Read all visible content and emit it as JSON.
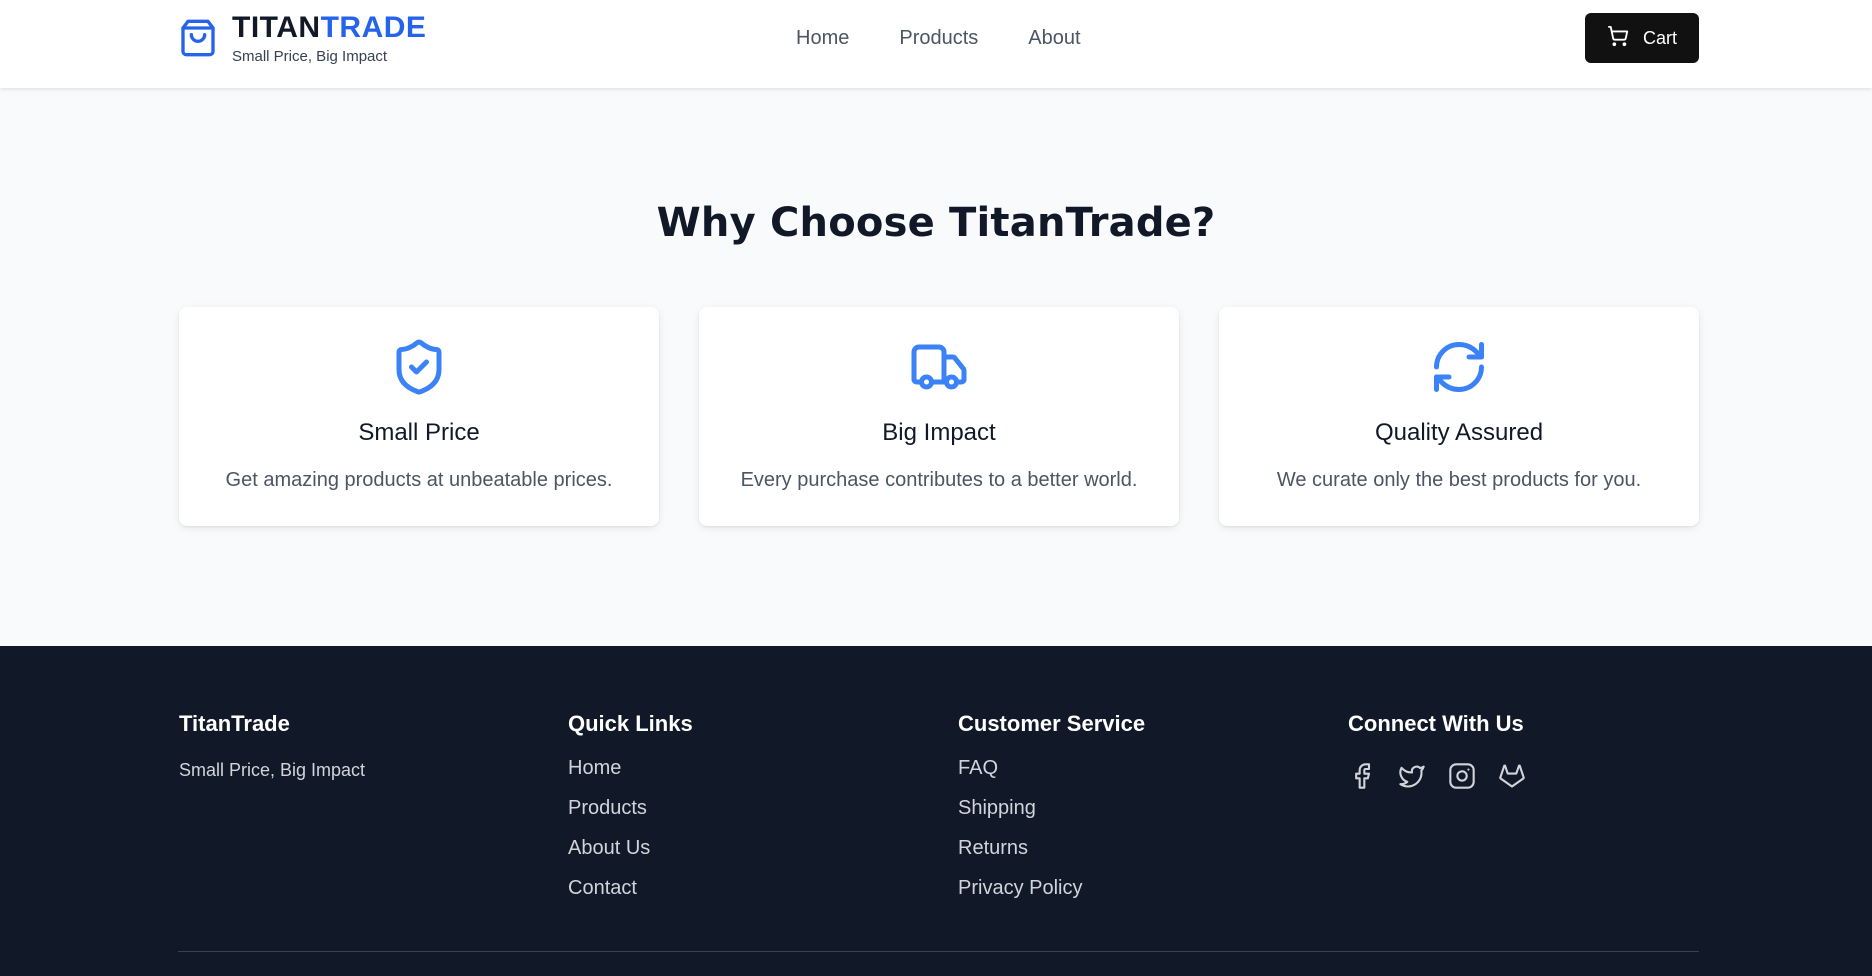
{
  "header": {
    "brand_part1": "TITAN",
    "brand_part2": "TRADE",
    "tagline": "Small Price, Big Impact",
    "nav": [
      "Home",
      "Products",
      "About"
    ],
    "cart_label": "Cart"
  },
  "features": {
    "title": "Why Choose TitanTrade?",
    "cards": [
      {
        "icon": "shield-check-icon",
        "title": "Small Price",
        "description": "Get amazing products at unbeatable prices."
      },
      {
        "icon": "truck-icon",
        "title": "Big Impact",
        "description": "Every purchase contributes to a better world."
      },
      {
        "icon": "refresh-icon",
        "title": "Quality Assured",
        "description": "We curate only the best products for you."
      }
    ]
  },
  "footer": {
    "brand": {
      "title": "TitanTrade",
      "tagline": "Small Price, Big Impact"
    },
    "quick_links": {
      "title": "Quick Links",
      "items": [
        "Home",
        "Products",
        "About Us",
        "Contact"
      ]
    },
    "customer_service": {
      "title": "Customer Service",
      "items": [
        "FAQ",
        "Shipping",
        "Returns",
        "Privacy Policy"
      ]
    },
    "connect": {
      "title": "Connect With Us",
      "icons": [
        "facebook-icon",
        "twitter-icon",
        "instagram-icon",
        "gitlab-icon"
      ]
    }
  },
  "colors": {
    "accent": "#2563eb",
    "icon_blue": "#3b82f6",
    "footer_bg": "#111827",
    "cart_bg": "#111111",
    "page_bg": "#f9fafb"
  }
}
